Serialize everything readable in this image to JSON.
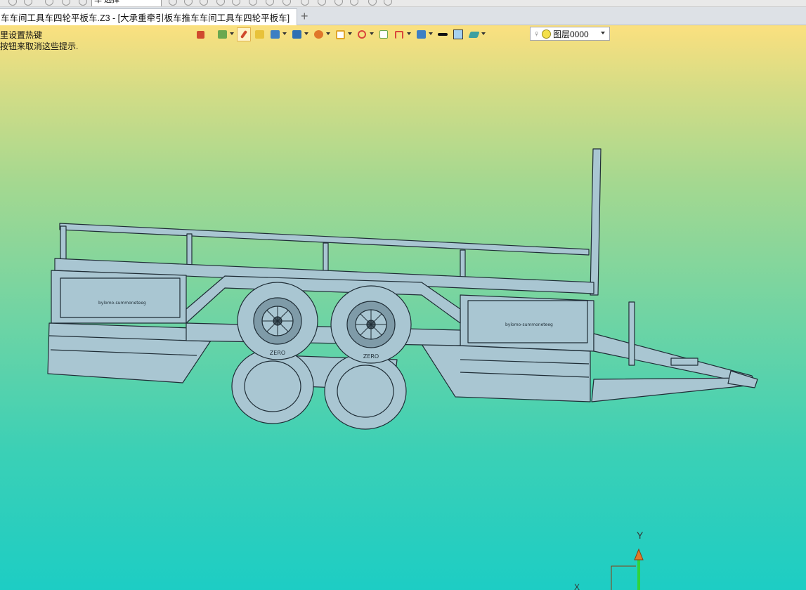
{
  "top_strip": {
    "combo_text": "车 选择"
  },
  "tab": {
    "title": "车车间工具车四轮平板车.Z3 - [大承重牵引板车推车车间工具车四轮平板车]",
    "close_icon": "close-icon",
    "new_tab_icon": "plus-icon"
  },
  "hints": {
    "line1": "里设置热键",
    "line2": "按钮来取消这些提示."
  },
  "toolbar": {
    "buttons": [
      {
        "name": "import-icon",
        "color": "#d04a2e"
      },
      {
        "name": "layers-icon",
        "color": "#6aa84f"
      },
      {
        "name": "pick-icon",
        "color": "#d04a2e"
      },
      {
        "name": "solid-yellow-icon",
        "color": "#e8c23a"
      },
      {
        "name": "solid-blue-icon",
        "color": "#3d7fc4"
      },
      {
        "name": "shade-icon",
        "color": "#2f6fb3"
      },
      {
        "name": "render-icon",
        "color": "#e0772a"
      },
      {
        "name": "view-frame-icon",
        "color": "#e0a62a"
      },
      {
        "name": "snap-icon",
        "color": "#d9453a"
      },
      {
        "name": "grid-icon",
        "color": "#6aa84f"
      },
      {
        "name": "dimension-icon",
        "color": "#d9453a"
      },
      {
        "name": "display-icon",
        "color": "#3d7fc4"
      },
      {
        "name": "line-color-icon",
        "color": "#111111"
      },
      {
        "name": "fill-color-icon",
        "color": "#a6d1f0"
      },
      {
        "name": "layer-stack-icon",
        "color": "#3da0a0"
      }
    ]
  },
  "layer": {
    "name": "图层0000"
  },
  "colors": {
    "model": "#a9c6d2",
    "model_edge": "#1f2d36"
  },
  "model": {
    "plate_text": "bylomo-summoneteeg",
    "tire_text": "ZERO"
  },
  "axis": {
    "y_label": "Y",
    "x_label": "X"
  }
}
